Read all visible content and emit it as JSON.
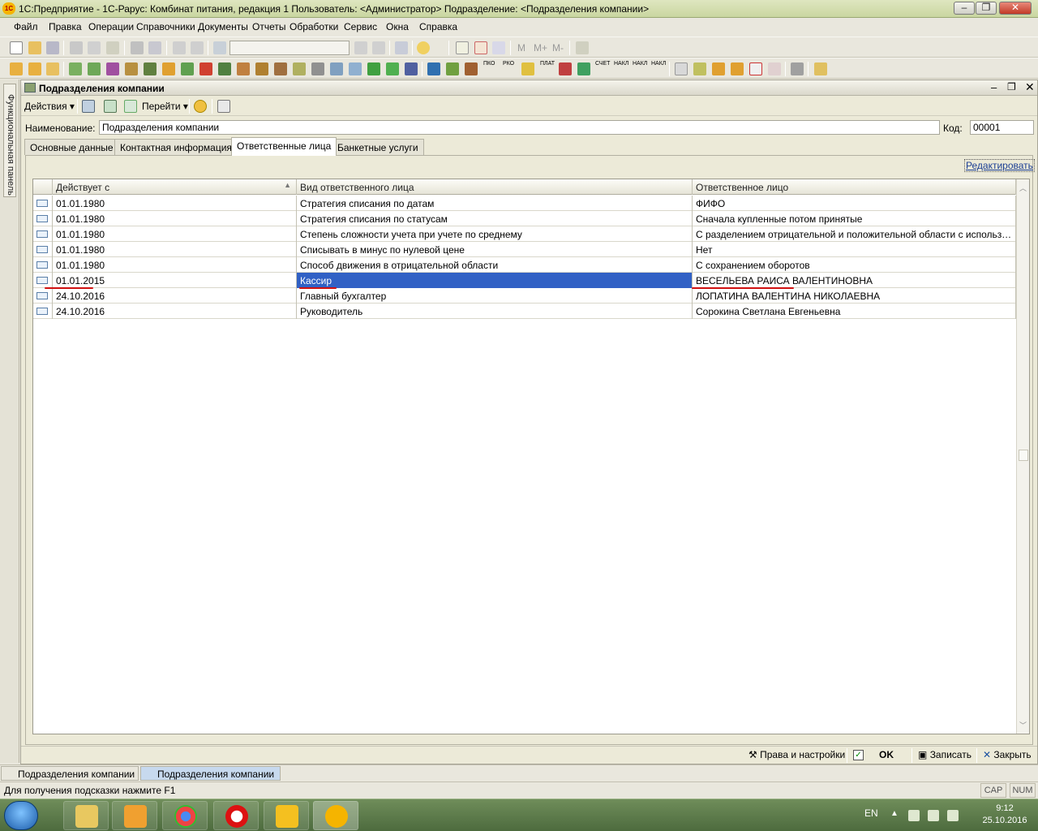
{
  "app": {
    "title": "1С:Предприятие - 1С-Рарус: Комбинат питания, редакция 1     Пользователь: <Администратор>     Подразделение: <Подразделения компании>",
    "logo_text": "1С"
  },
  "menu": [
    "Файл",
    "Правка",
    "Операции",
    "Справочники",
    "Документы",
    "Отчеты",
    "Обработки",
    "Сервис",
    "Окна",
    "Справка"
  ],
  "toolbar": {
    "memory_buttons": [
      "M",
      "M+",
      "M-"
    ]
  },
  "toolbar2": {
    "labels": [
      "ПКО",
      "РКО",
      "ПЛАТ",
      "СЧЕТ",
      "НАКЛ",
      "НАКЛ",
      "НАКЛ"
    ]
  },
  "side_panel": {
    "label": "Функциональная панель"
  },
  "document": {
    "title": "Подразделения компании",
    "actions_label": "Действия",
    "goto_label": "Перейти",
    "name_label": "Наименование:",
    "name_value": "Подразделения компании",
    "code_label": "Код:",
    "code_value": "00001",
    "tabs": [
      "Основные данные",
      "Контактная информация",
      "Ответственные лица",
      "Банкетные услуги"
    ],
    "active_tab": 2,
    "edit_link": "Редактировать",
    "table": {
      "columns": [
        "Действует с",
        "Вид ответственного лица",
        "Ответственное лицо"
      ],
      "rows": [
        {
          "date": "01.01.1980",
          "kind": "Стратегия списания по датам",
          "person": "ФИФО"
        },
        {
          "date": "01.01.1980",
          "kind": "Стратегия списания по статусам",
          "person": "Сначала купленные потом принятые"
        },
        {
          "date": "01.01.1980",
          "kind": "Степень сложности учета при учете по среднему",
          "person": "С разделением отрицательной и положительной области с использование..."
        },
        {
          "date": "01.01.1980",
          "kind": "Списывать в минус по нулевой цене",
          "person": "Нет"
        },
        {
          "date": "01.01.1980",
          "kind": "Способ движения в отрицательной области",
          "person": "С сохранением оборотов"
        },
        {
          "date": "01.01.2015",
          "kind": "Кассир",
          "person": "ВЕСЕЛЬЕВА РАИСА ВАЛЕНТИНОВНА"
        },
        {
          "date": "24.10.2016",
          "kind": "Главный бухгалтер",
          "person": "ЛОПАТИНА ВАЛЕНТИНА НИКОЛАЕВНА"
        },
        {
          "date": "24.10.2016",
          "kind": "Руководитель",
          "person": "Сорокина Светлана Евгеньевна"
        }
      ],
      "selected_row": 5
    },
    "bottom": {
      "rights_label": "Права и настройки",
      "ok_label": "OK",
      "save_label": "Записать",
      "close_label": "Закрыть"
    }
  },
  "window_tabs": [
    "Подразделения компании",
    "Подразделения компании"
  ],
  "status": {
    "hint": "Для получения подсказки нажмите F1",
    "cap": "CAP",
    "num": "NUM"
  },
  "taskbar": {
    "lang": "EN",
    "time": "9:12",
    "date": "25.10.2016"
  },
  "colors": {
    "selection": "#3161c5",
    "annotation_red": "#d01010",
    "title_bar": "#c9d6a0"
  }
}
